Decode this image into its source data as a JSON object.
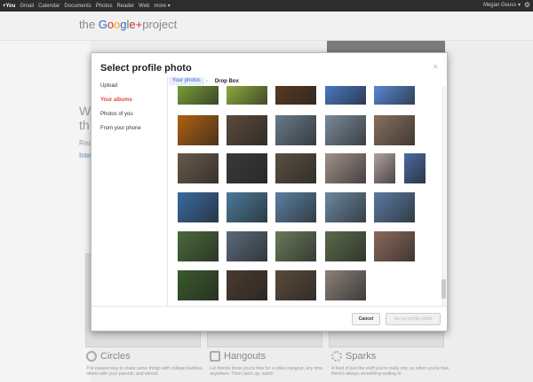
{
  "gbar": {
    "items": [
      "+You",
      "Gmail",
      "Calendar",
      "Documents",
      "Photos",
      "Reader",
      "Web",
      "more ▾"
    ],
    "user": "Megan Geuss ▾"
  },
  "logo": {
    "prefix": "the ",
    "g1": "G",
    "o1": "o",
    "o2": "o",
    "g2": "g",
    "l": "l",
    "e": "e",
    "plus": "+",
    "suffix": "project"
  },
  "background": {
    "heading_frag": "W",
    "heading_frag2": "th",
    "read_frag": "Rea",
    "link_frag": "Inte",
    "features": [
      {
        "title": "Circles",
        "desc": "The easiest way to share some things with college buddies, others with your parents, and almost"
      },
      {
        "title": "Hangouts",
        "desc": "Let friends know you're free for a video hangout, any time, anywhere. Then catch up, watch"
      },
      {
        "title": "Sparks",
        "desc": "A feed of just the stuff you're really into, so when you're free, there's always something waiting to"
      }
    ]
  },
  "dialog": {
    "title": "Select profile photo",
    "close": "×",
    "sidebar": [
      {
        "label": "Upload",
        "selected": false
      },
      {
        "label": "Your albums",
        "selected": true
      },
      {
        "label": "Photos of you",
        "selected": false
      },
      {
        "label": "From your phone",
        "selected": false
      }
    ],
    "breadcrumb": {
      "album": "Your photos",
      "current": "Drop Box",
      "sep": "›"
    },
    "cancel": "Cancel",
    "set": "Set as profile photo"
  },
  "photo_rows": [
    [
      "#7aa03a",
      "#8fae3e",
      "#5a3a20",
      "#4a7ac8",
      "#5a8ad8"
    ],
    [
      "#b06010",
      "#5a4a3a",
      "#6a7a8a",
      "#7a8a9a",
      "#8a7060"
    ],
    [
      "#6a5a4a",
      "#3a3a3a",
      "#5a5040",
      "#4a3a5a",
      "#a0908a",
      "#b0a0a0",
      "#4a6aa0"
    ],
    [
      "#3a6aa0",
      "#4a7a9a",
      "#5a80a0",
      "#6a88a0",
      "#5a7aa0"
    ],
    [
      "#4a6a3a",
      "#5a6a7a",
      "#6a7a5a",
      "#5a6a4a",
      "#8a6a5a"
    ],
    [
      "#3a5a2a",
      "#4a3a30",
      "#5a4a3a",
      "#8a8078"
    ]
  ]
}
